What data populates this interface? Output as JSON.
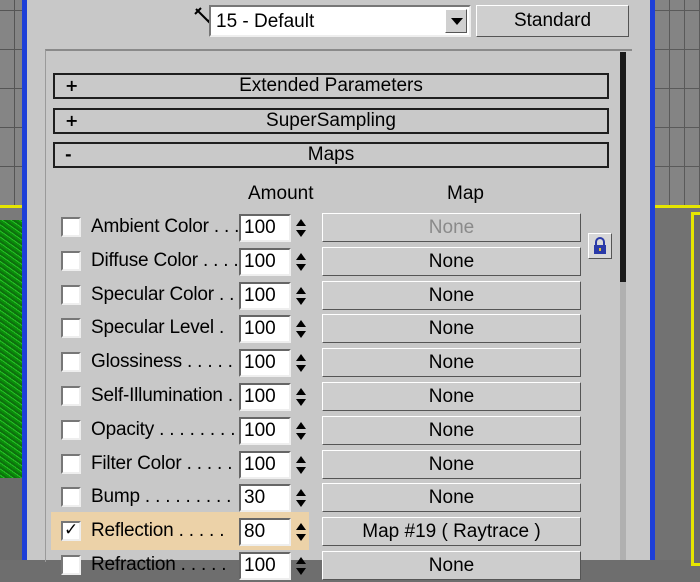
{
  "toolbar": {
    "material_name": "15 - Default",
    "type_button": "Standard"
  },
  "rollouts": [
    {
      "sign": "+",
      "label": "Extended Parameters"
    },
    {
      "sign": "+",
      "label": "SuperSampling"
    },
    {
      "sign": "-",
      "label": "Maps"
    }
  ],
  "maps": {
    "col_amount": "Amount",
    "col_map": "Map",
    "rows": [
      {
        "label": "Ambient Color . . .",
        "amount": "100",
        "map": "None",
        "checked": false,
        "dim": true
      },
      {
        "label": "Diffuse Color . . . .",
        "amount": "100",
        "map": "None",
        "checked": false
      },
      {
        "label": "Specular Color  . .",
        "amount": "100",
        "map": "None",
        "checked": false
      },
      {
        "label": "Specular Level  .",
        "amount": "100",
        "map": "None",
        "checked": false
      },
      {
        "label": "Glossiness  . . . . .",
        "amount": "100",
        "map": "None",
        "checked": false
      },
      {
        "label": "Self-Illumination .",
        "amount": "100",
        "map": "None",
        "checked": false
      },
      {
        "label": "Opacity . . . . . . . .",
        "amount": "100",
        "map": "None",
        "checked": false
      },
      {
        "label": "Filter Color  . . . . .",
        "amount": "100",
        "map": "None",
        "checked": false
      },
      {
        "label": "Bump  . . . . . . . . .",
        "amount": "30",
        "map": "None",
        "checked": false
      },
      {
        "label": "Reflection  . . . . .",
        "amount": "80",
        "map": "Map #19  ( Raytrace )",
        "checked": true,
        "highlight": true
      },
      {
        "label": "Refraction  . . . . .",
        "amount": "100",
        "map": "None",
        "checked": false
      }
    ]
  },
  "check_mark": "✓",
  "colors": {
    "panel": "#c8c8c8",
    "highlight": "#ecd2a8",
    "border_blue": "#1d3fd8"
  }
}
